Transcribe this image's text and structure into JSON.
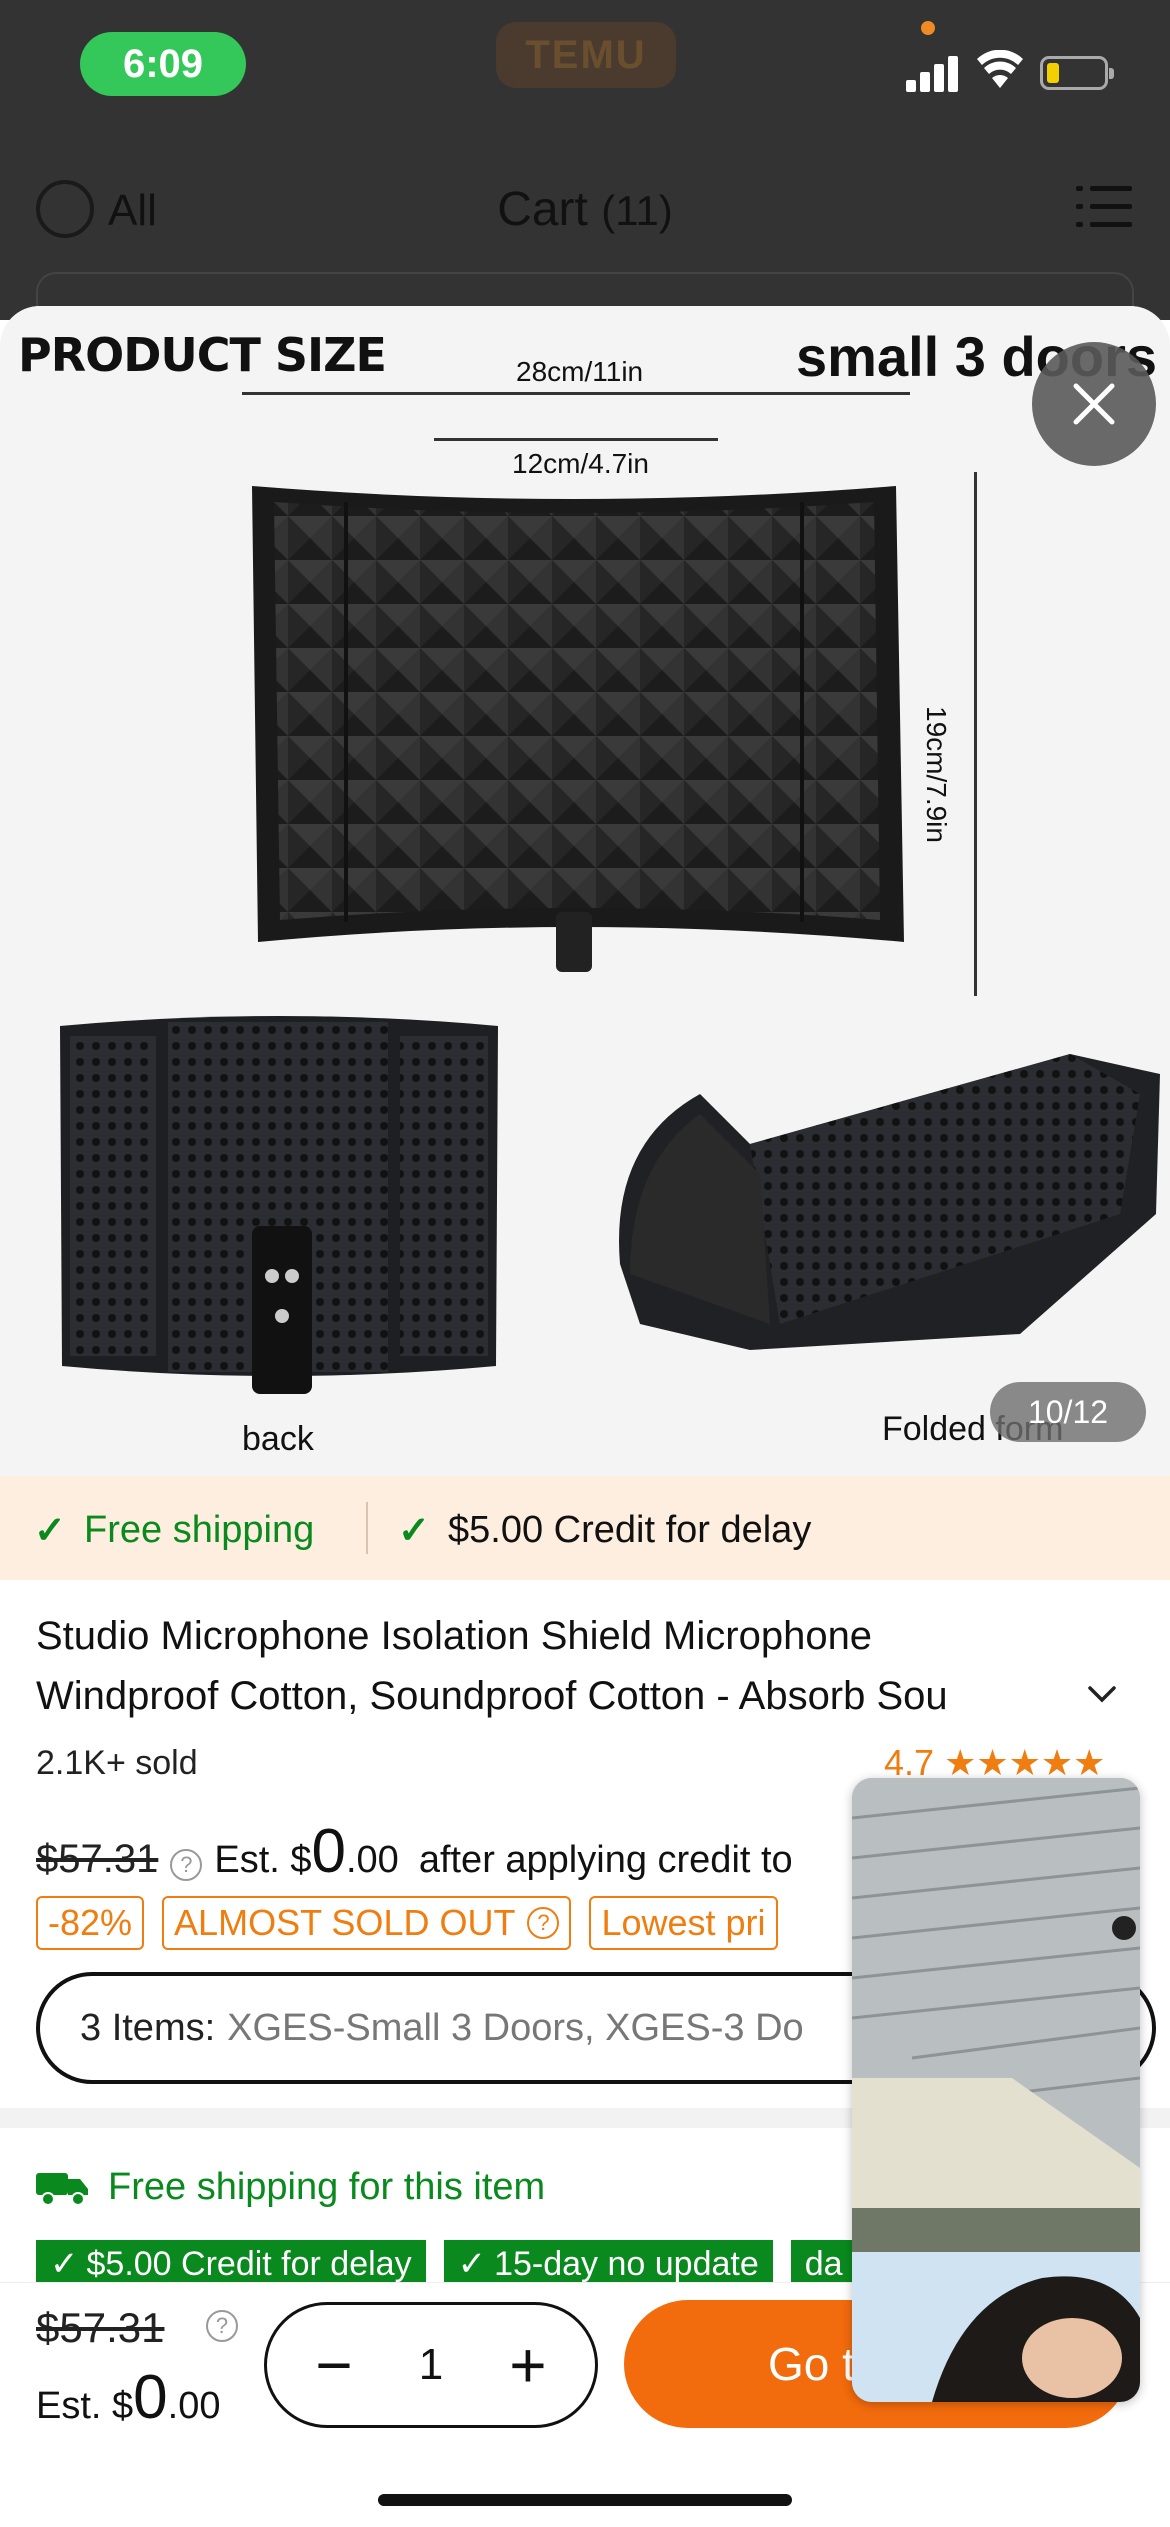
{
  "status_bar": {
    "time": "6:09",
    "background_app": "TEMU"
  },
  "cart_header": {
    "select_all_label": "All",
    "title": "Cart",
    "count": "(11)"
  },
  "gallery": {
    "heading": "PRODUCT SIZE",
    "variant_text": "small 3 doors",
    "width_label": "28cm/11in",
    "inner_width_label": "12cm/4.7in",
    "height_label": "19cm/7.9in",
    "caption_back": "back",
    "caption_folded": "Folded form",
    "page_counter": "10/12"
  },
  "shipping_banner": {
    "free_shipping": "Free shipping",
    "credit": "$5.00 Credit for delay"
  },
  "product": {
    "title_line1": "Studio Microphone Isolation Shield Microphone",
    "title_line2": "Windproof Cotton, Soundproof Cotton - Absorb Sou",
    "sold": "2.1K+ sold",
    "rating": "4.7",
    "rating_stars": 5,
    "original_price": "$57.31",
    "est_prefix": "Est. $",
    "est_whole": "0",
    "est_cents": ".00",
    "after_credit": "after applying credit to",
    "badges": [
      "-82%",
      "ALMOST SOLD OUT",
      "Lowest pri"
    ],
    "items_label": "3 Items:",
    "items_value": "XGES-Small 3 Doors, XGES-3 Do"
  },
  "shipping_section": {
    "free_item": "Free shipping for this item",
    "tags": [
      "$5.00 Credit for delay",
      "15-day no update",
      "da"
    ]
  },
  "bottom_bar": {
    "original_price": "$57.31",
    "est_prefix": "Est. $",
    "est_whole": "0",
    "est_cents": ".00",
    "quantity": "1",
    "go_button": "Go t"
  },
  "colors": {
    "accent_orange": "#f26b0c",
    "green": "#0a8a1e",
    "badge_orange": "#ef7d10",
    "status_green": "#34c759"
  }
}
